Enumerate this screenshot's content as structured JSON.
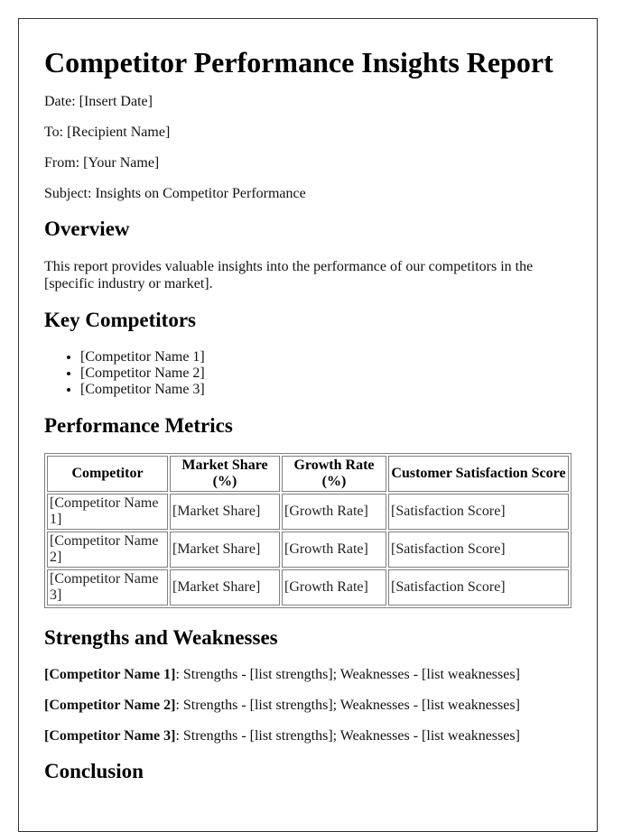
{
  "title": "Competitor Performance Insights Report",
  "meta": {
    "date": "Date: [Insert Date]",
    "to": "To: [Recipient Name]",
    "from": "From: [Your Name]",
    "subject": "Subject: Insights on Competitor Performance"
  },
  "overview": {
    "heading": "Overview",
    "text": "This report provides valuable insights into the performance of our competitors in the [specific industry or market]."
  },
  "key_competitors": {
    "heading": "Key Competitors",
    "items": [
      "[Competitor Name 1]",
      "[Competitor Name 2]",
      "[Competitor Name 3]"
    ]
  },
  "metrics": {
    "heading": "Performance Metrics",
    "columns": [
      "Competitor",
      "Market Share (%)",
      "Growth Rate (%)",
      "Customer Satisfaction Score"
    ],
    "rows": [
      [
        "[Competitor Name 1]",
        "[Market Share]",
        "[Growth Rate]",
        "[Satisfaction Score]"
      ],
      [
        "[Competitor Name 2]",
        "[Market Share]",
        "[Growth Rate]",
        "[Satisfaction Score]"
      ],
      [
        "[Competitor Name 3]",
        "[Market Share]",
        "[Growth Rate]",
        "[Satisfaction Score]"
      ]
    ]
  },
  "strengths_weaknesses": {
    "heading": "Strengths and Weaknesses",
    "items": [
      {
        "name": "[Competitor Name 1]",
        "text": ": Strengths - [list strengths]; Weaknesses - [list weaknesses]"
      },
      {
        "name": "[Competitor Name 2]",
        "text": ": Strengths - [list strengths]; Weaknesses - [list weaknesses]"
      },
      {
        "name": "[Competitor Name 3]",
        "text": ": Strengths - [list strengths]; Weaknesses - [list weaknesses]"
      }
    ]
  },
  "conclusion": {
    "heading": "Conclusion"
  }
}
